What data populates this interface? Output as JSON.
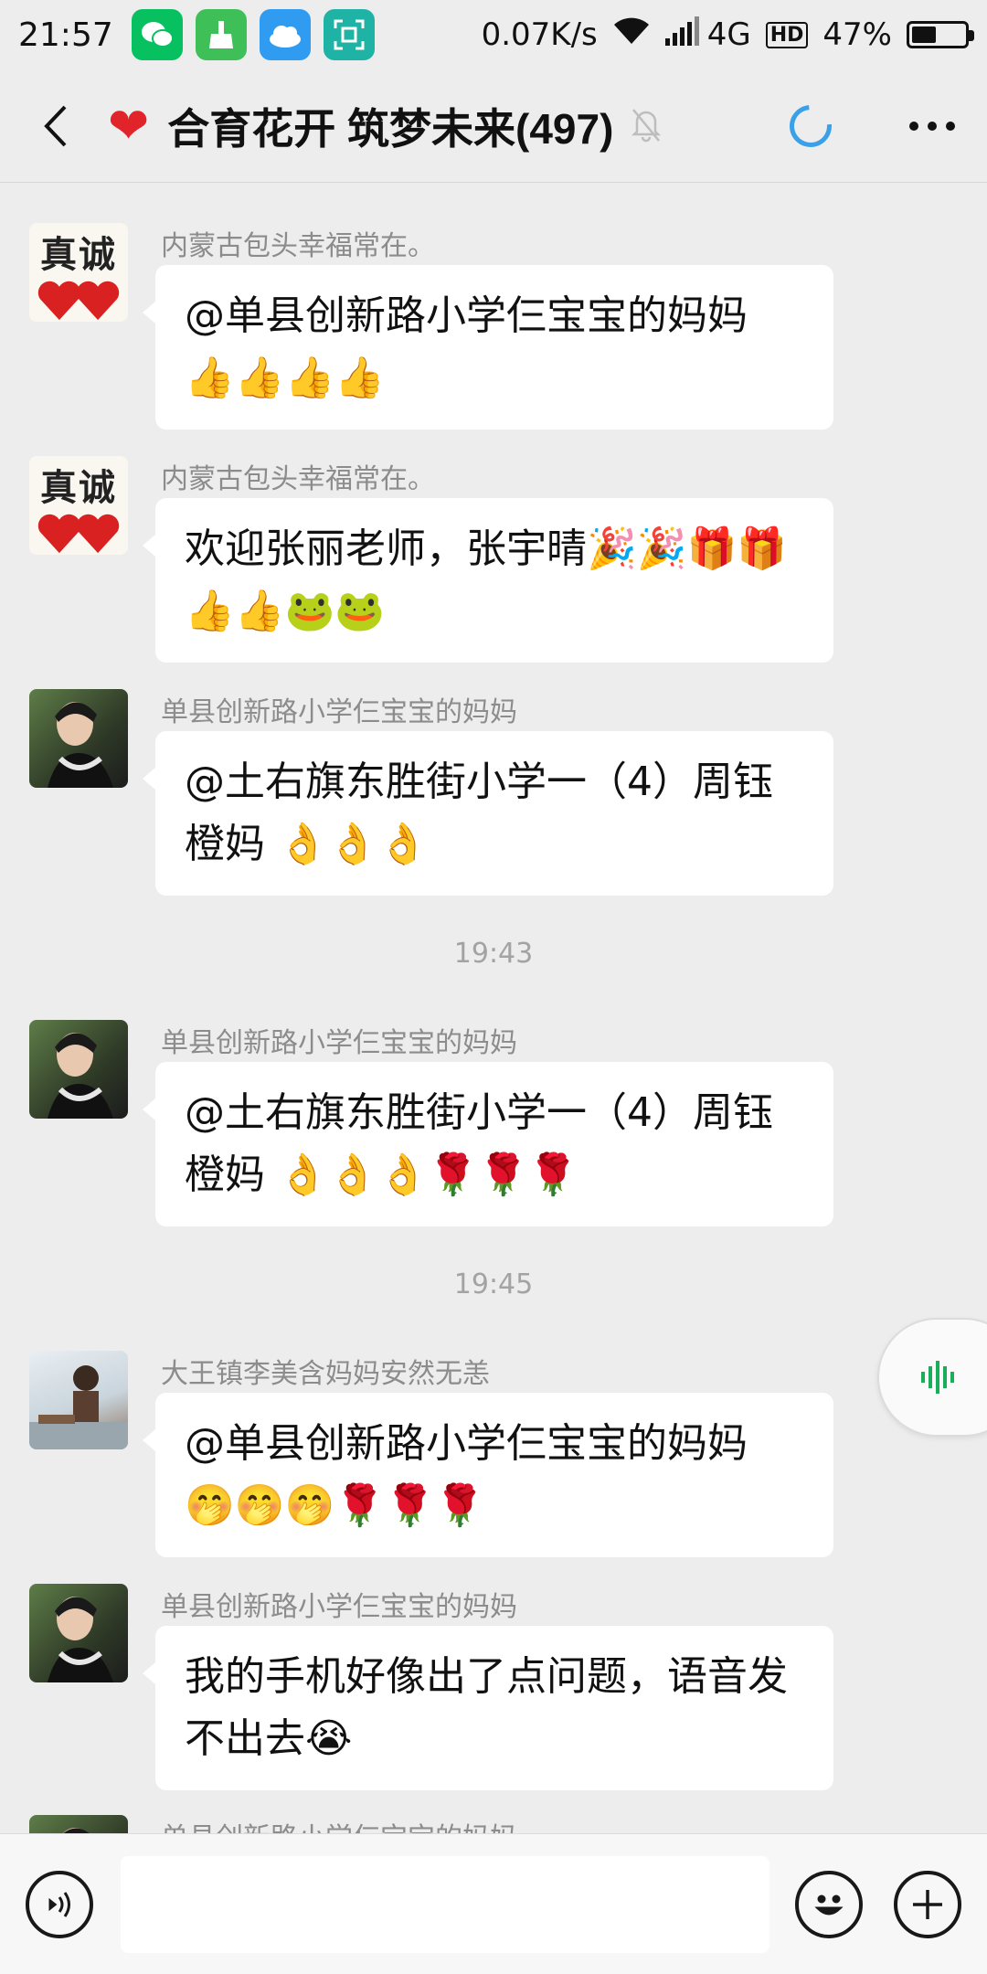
{
  "status_bar": {
    "time": "21:57",
    "net_speed": "0.07K/s",
    "network": "4G",
    "hd": "HD",
    "battery_percent": "47%",
    "battery_level": 0.47,
    "app_icons": [
      "wechat-icon",
      "broom-icon",
      "weather-icon",
      "scan-icon"
    ]
  },
  "header": {
    "title": "合育花开 筑梦未来(497)",
    "heart": "❤",
    "muted": true
  },
  "messages": [
    {
      "sender": "内蒙古包头幸福常在。",
      "avatar": "zhencheng",
      "avatar_text": "真诚",
      "text": "@单县创新路小学仨宝宝的妈妈",
      "emoji": "👍👍👍👍"
    },
    {
      "sender": "内蒙古包头幸福常在。",
      "avatar": "zhencheng",
      "avatar_text": "真诚",
      "text": "欢迎张丽老师，张宇晴🎉🎉🎁🎁",
      "emoji": "👍👍🐸🐸"
    },
    {
      "sender": "单县创新路小学仨宝宝的妈妈",
      "avatar": "woman",
      "text": "@土右旗东胜街小学一（4）周钰",
      "text2": "橙妈 👌👌👌"
    },
    {
      "sender": "单县创新路小学仨宝宝的妈妈",
      "avatar": "woman",
      "text": "@土右旗东胜街小学一（4）周钰",
      "text2": "橙妈 👌👌👌🌹🌹🌹"
    },
    {
      "sender": "大王镇李美含妈妈安然无恙",
      "avatar": "child",
      "text": "@单县创新路小学仨宝宝的妈妈",
      "emoji": "🤭🤭🤭🌹🌹🌹"
    },
    {
      "sender": "单县创新路小学仨宝宝的妈妈",
      "avatar": "woman",
      "text": "我的手机好像出了点问题，语音发",
      "text2": "不出去😭"
    },
    {
      "sender": "单县创新路小学仨宝宝的妈妈",
      "avatar": "woman"
    }
  ],
  "time_separators": [
    "19:43",
    "19:45"
  ],
  "input": {
    "value": "",
    "placeholder": ""
  }
}
